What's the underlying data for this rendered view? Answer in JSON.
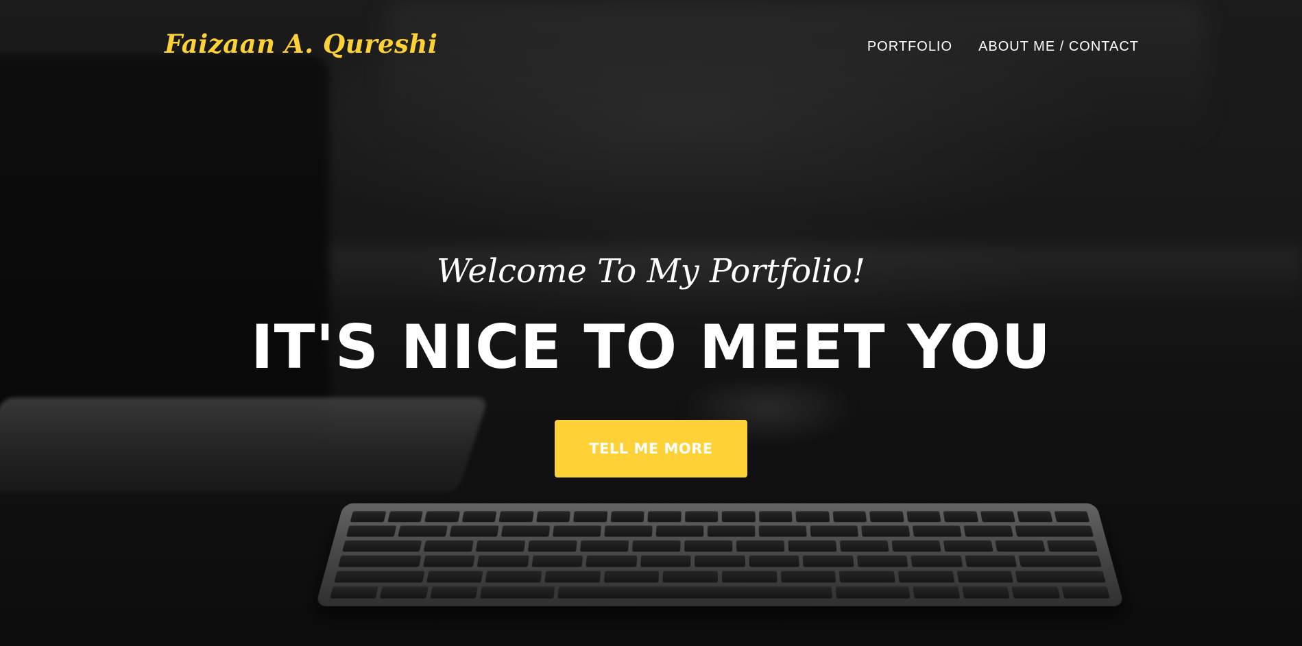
{
  "brand": {
    "name": "Faizaan A. Qureshi",
    "color": "#fed136"
  },
  "nav": {
    "items": [
      {
        "label": "PORTFOLIO"
      },
      {
        "label": "ABOUT ME / CONTACT"
      }
    ]
  },
  "hero": {
    "lead_in": "Welcome To My Portfolio!",
    "heading": "IT'S NICE TO MEET YOU",
    "cta_label": "TELL ME MORE",
    "cta_color": "#fed136",
    "background": "dark blurred desk photo with keyboard, laptop and mouse"
  }
}
